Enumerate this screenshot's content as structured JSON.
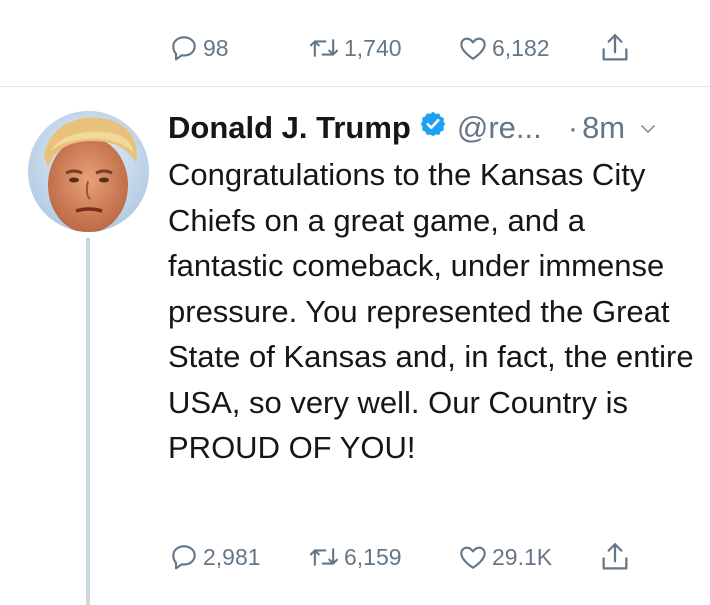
{
  "previous_tweet": {
    "reply_count": "98",
    "retweet_count": "1,740",
    "like_count": "6,182"
  },
  "tweet": {
    "author_name": "Donald J. Trump",
    "handle": "@re...",
    "dot": "·",
    "time": "8m",
    "text": "Congratulations to the Kansas City Chiefs on a great game, and a fantastic comeback, under immense pressure. You represented the Great State of Kansas and, in fact, the entire USA, so very well. Our Country is PROUD OF YOU!",
    "reply_count": "2,981",
    "retweet_count": "6,159",
    "like_count": "29.1K"
  },
  "colors": {
    "text": "#14171a",
    "secondary": "#657786",
    "verified": "#1da1f2",
    "divider": "#e1e8ed",
    "thread_line": "#ccd6dd"
  },
  "icons": [
    "reply-icon",
    "retweet-icon",
    "like-icon",
    "share-icon",
    "verified-badge-icon",
    "chevron-down-icon"
  ]
}
